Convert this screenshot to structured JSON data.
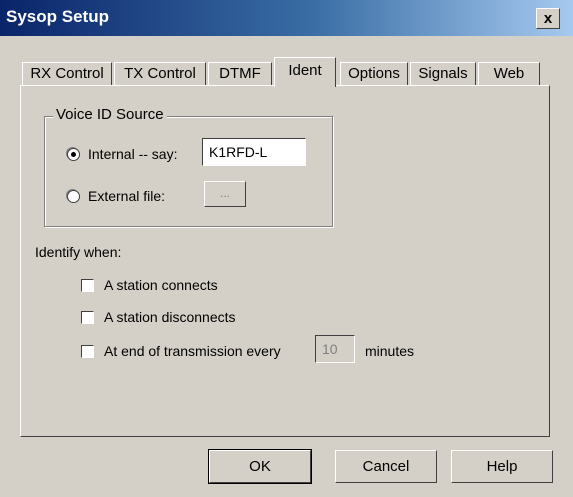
{
  "window": {
    "title": "Sysop Setup",
    "close_glyph": "x"
  },
  "tabs": [
    {
      "label": "RX Control"
    },
    {
      "label": "TX Control"
    },
    {
      "label": "DTMF"
    },
    {
      "label": "Ident"
    },
    {
      "label": "Options"
    },
    {
      "label": "Signals"
    },
    {
      "label": "Web"
    }
  ],
  "active_tab": "Ident",
  "voice_id": {
    "legend": "Voice ID Source",
    "internal_label": "Internal -- say:",
    "internal_value": "K1RFD-L",
    "internal_selected": true,
    "external_label": "External file:",
    "browse_label": "..."
  },
  "identify": {
    "heading": "Identify when:",
    "station_connects": "A station connects",
    "station_disconnects": "A station disconnects",
    "end_of_tx": "At end of transmission every",
    "interval_value": "10",
    "interval_unit": "minutes"
  },
  "buttons": {
    "ok": "OK",
    "cancel": "Cancel",
    "help": "Help"
  }
}
